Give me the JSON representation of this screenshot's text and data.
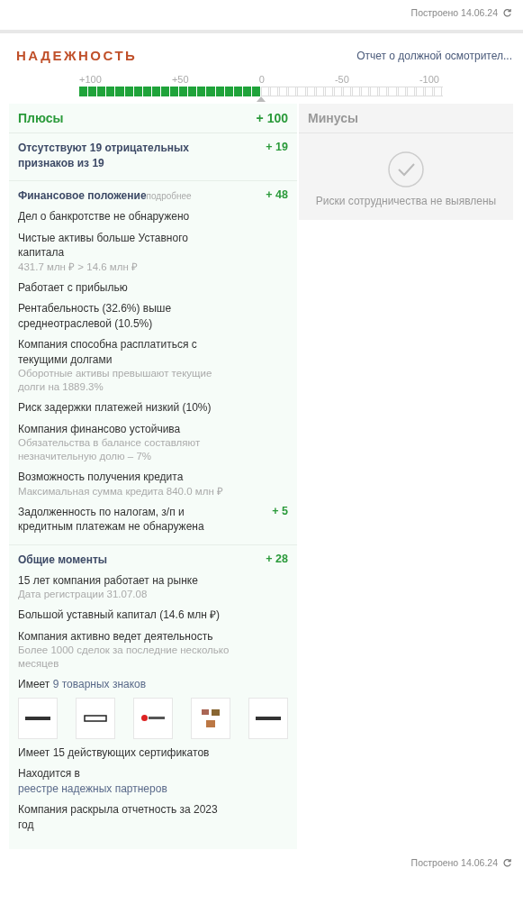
{
  "top_status": {
    "text": "Построено 14.06.24"
  },
  "section": {
    "title": "НАДЕЖНОСТЬ",
    "report_link": "Отчет о должной осмотрител..."
  },
  "scale": {
    "ticks": [
      "+100",
      "+50",
      "0",
      "-50",
      "-100"
    ],
    "level": 0.5
  },
  "pluses": {
    "title": "Плюсы",
    "score": "+ 100",
    "groups": [
      {
        "title": "Отсутствуют 19 отрицательных признаков из 19",
        "score": "+ 19"
      },
      {
        "title": "Финансовое положение",
        "more": "подробнее",
        "score": "+ 48",
        "items": [
          {
            "text": "Дел о банкротстве не обнаружено"
          },
          {
            "text": "Чистые активы больше Уставного капитала",
            "note": "431.7 млн ₽ > 14.6 млн ₽"
          },
          {
            "text": "Работает с прибылью"
          },
          {
            "text": "Рентабельность (32.6%) выше среднеотраслевой (10.5%)"
          },
          {
            "text": "Компания способна расплатиться с текущими долгами",
            "note": "Оборотные активы превышают текущие долги на 1889.3%"
          },
          {
            "text": "Риск задержки платежей низкий (10%)"
          },
          {
            "text": "Компания финансово устойчива",
            "note": "Обязательства в балансе составляют незначительную долю – 7%"
          },
          {
            "text": "Возможность получения кредита",
            "note": "Максимальная сумма кредита 840.0 млн ₽"
          },
          {
            "text": "Задолженность по налогам, з/п и кредитным платежам не обнаружена",
            "score": "+ 5"
          }
        ]
      },
      {
        "title": "Общие моменты",
        "score": "+ 28",
        "items": [
          {
            "text": "15 лет компания работает на рынке",
            "note": "Дата регистрации 31.07.08"
          },
          {
            "text": "Большой уставный капитал (14.6 млн ₽)"
          },
          {
            "text": "Компания активно ведет деятельность",
            "note": "Более 1000 сделок за последние несколько месяцев"
          },
          {
            "text": "Имеет",
            "link": "9 товарных знаков"
          },
          {
            "text": "Имеет 15 действующих сертификатов"
          },
          {
            "text": "Находится в",
            "link": "реестре надежных партнеров"
          },
          {
            "text": "Компания раскрыла отчетность за 2023 год"
          }
        ]
      }
    ]
  },
  "minuses": {
    "title": "Минусы",
    "empty_text": "Риски сотрудничества не выявлены"
  },
  "bottom_status": {
    "text": "Построено 14.06.24"
  }
}
